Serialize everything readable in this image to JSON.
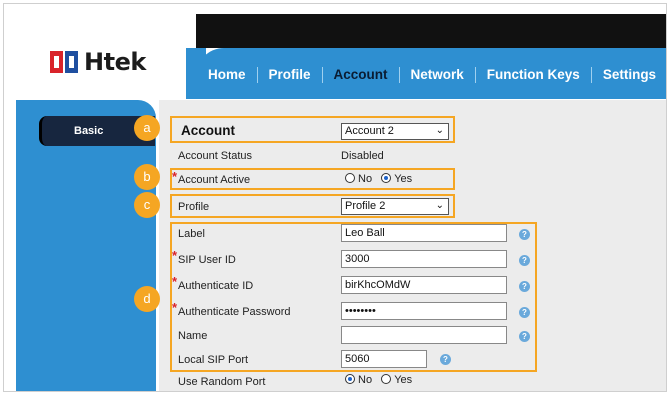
{
  "logo": {
    "text": "tek",
    "letter": "H"
  },
  "nav": {
    "items": [
      "Home",
      "Profile",
      "Account",
      "Network",
      "Function Keys",
      "Settings"
    ],
    "active": "Account"
  },
  "sidebar": {
    "tab_label": "Basic"
  },
  "account": {
    "title": "Account",
    "account_select": "Account 2",
    "status_label": "Account Status",
    "status_value": "Disabled",
    "active_label": "Account Active",
    "no_label": "No",
    "yes_label": "Yes",
    "profile_label": "Profile",
    "profile_select": "Profile 2",
    "label_label": "Label",
    "label_value": "Leo Ball",
    "sip_user_label": "SIP User ID",
    "sip_user_value": "3000",
    "auth_id_label": "Authenticate ID",
    "auth_id_value": "birKhcOMdW",
    "auth_pw_label": "Authenticate Password",
    "auth_pw_value": "••••••••",
    "name_label": "Name",
    "name_value": "",
    "local_port_label": "Local SIP Port",
    "local_port_value": "5060",
    "random_port_label": "Use Random Port",
    "random_no": "No",
    "random_yes": "Yes"
  },
  "badges": [
    "a",
    "b",
    "c",
    "d"
  ],
  "help_glyph": "?",
  "colors": {
    "nav_blue": "#2e8fd1",
    "highlight_orange": "#f5a623",
    "required_red": "#d9232a"
  }
}
